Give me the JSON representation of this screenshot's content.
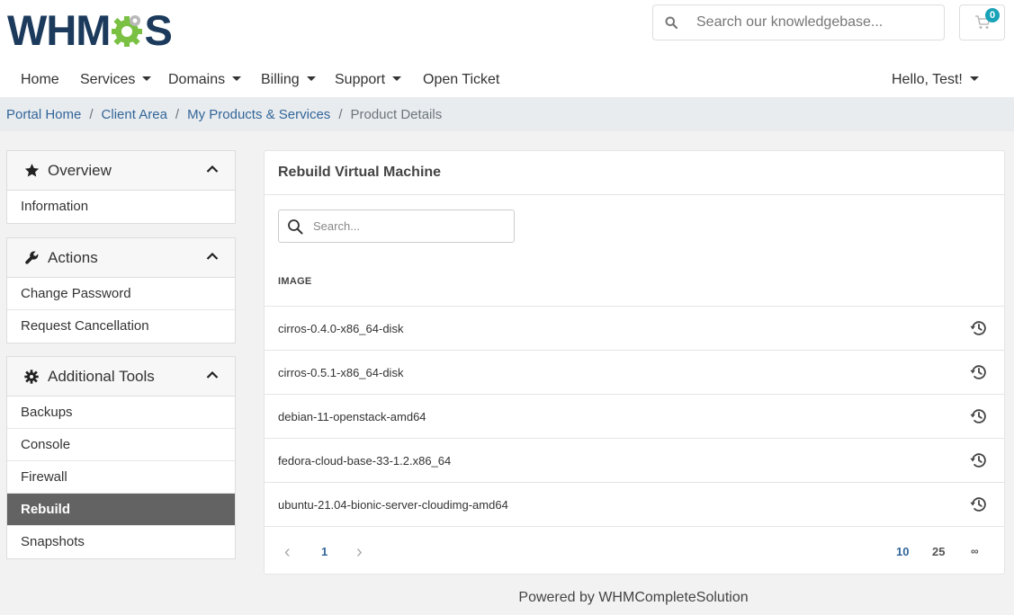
{
  "brand": {
    "logo_left": "WHM",
    "logo_right": "S"
  },
  "header": {
    "search_placeholder": "Search our knowledgebase...",
    "cart_count": "0"
  },
  "nav": {
    "home": "Home",
    "services": "Services",
    "domains": "Domains",
    "billing": "Billing",
    "support": "Support",
    "open_ticket": "Open Ticket",
    "user_greeting": "Hello, Test!"
  },
  "breadcrumb": [
    "Portal Home",
    "Client Area",
    "My Products & Services",
    "Product Details"
  ],
  "sidebar": {
    "overview": {
      "title": "Overview",
      "items": [
        "Information"
      ]
    },
    "actions": {
      "title": "Actions",
      "items": [
        "Change Password",
        "Request Cancellation"
      ]
    },
    "tools": {
      "title": "Additional Tools",
      "items": [
        "Backups",
        "Console",
        "Firewall",
        "Rebuild",
        "Snapshots"
      ],
      "active": "Rebuild"
    }
  },
  "main": {
    "title": "Rebuild Virtual Machine",
    "search_placeholder": "Search...",
    "column_header": "IMAGE",
    "images": [
      "cirros-0.4.0-x86_64-disk",
      "cirros-0.5.1-x86_64-disk",
      "debian-11-openstack-amd64",
      "fedora-cloud-base-33-1.2.x86_64",
      "ubuntu-21.04-bionic-server-cloudimg-amd64"
    ],
    "pagination": {
      "prev": "‹",
      "page": "1",
      "next": "›",
      "sizes": [
        "10",
        "25",
        "∞"
      ]
    }
  },
  "footer": {
    "text": "Powered by WHMCompleteSolution"
  },
  "colors": {
    "brand_navy": "#1b3a5c",
    "brand_green": "#7ac143",
    "link": "#336699",
    "active_item": "#636363",
    "badge": "#1aa3b8"
  }
}
